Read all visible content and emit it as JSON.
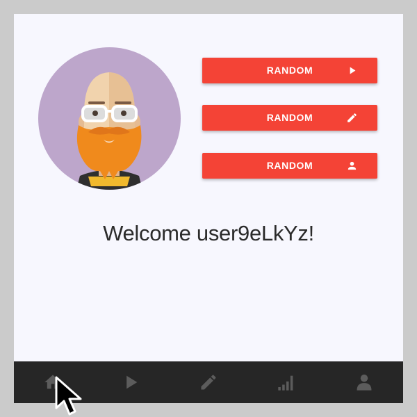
{
  "profile": {
    "avatar_icon": "bearded-man-avatar",
    "welcome_text": "Welcome user9eLkYz!"
  },
  "actions": [
    {
      "label": "RANDOM",
      "icon": "play-icon"
    },
    {
      "label": "RANDOM",
      "icon": "pencil-icon"
    },
    {
      "label": "RANDOM",
      "icon": "person-icon"
    }
  ],
  "nav": {
    "items": [
      {
        "icon": "home-icon",
        "active": true
      },
      {
        "icon": "play-icon",
        "active": false
      },
      {
        "icon": "pencil-icon",
        "active": false
      },
      {
        "icon": "signal-bars-icon",
        "active": false
      },
      {
        "icon": "person-icon",
        "active": false
      }
    ]
  },
  "colors": {
    "accent": "#f44336",
    "page_background": "#f7f7fe",
    "navbar_background": "#262626",
    "nav_icon": "#5c5c5c",
    "avatar_background": "#bda6cb"
  }
}
